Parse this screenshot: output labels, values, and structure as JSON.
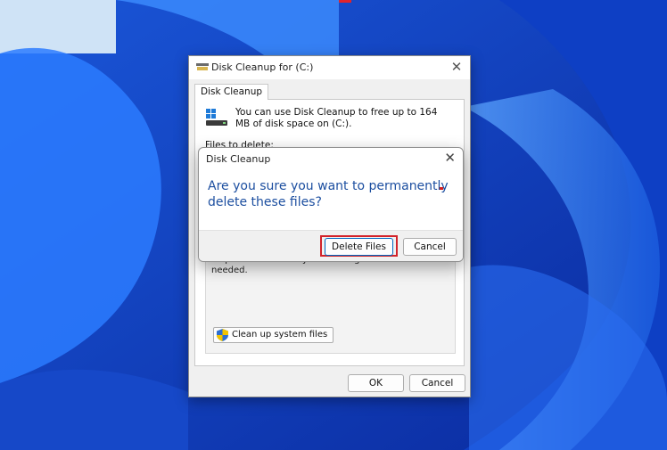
{
  "main_window": {
    "title": "Disk Cleanup for  (C:)",
    "tab_label": "Disk Cleanup",
    "intro_text": "You can use Disk Cleanup to free up to 164 MB of disk space on  (C:).",
    "files_label": "Files to delete:",
    "description": "Clean up files created by the graphics system which can speed up application load time and improve responsiveness. They will be re-generated as needed.",
    "cleanup_system_files_label": "Clean up system files",
    "ok_label": "OK",
    "cancel_label": "Cancel"
  },
  "dialog": {
    "title": "Disk Cleanup",
    "message": "Are you sure you want to permanently delete these files?",
    "delete_label": "Delete Files",
    "cancel_label": "Cancel"
  },
  "icons": {
    "close": "close-icon",
    "drive": "drive-icon",
    "shield": "shield-icon",
    "window": "disk-cleanup-icon"
  },
  "colors": {
    "accent_highlight": "#d2232a",
    "message_text": "#1d4fa0",
    "wallpaper_blue": "#1e63d6"
  }
}
